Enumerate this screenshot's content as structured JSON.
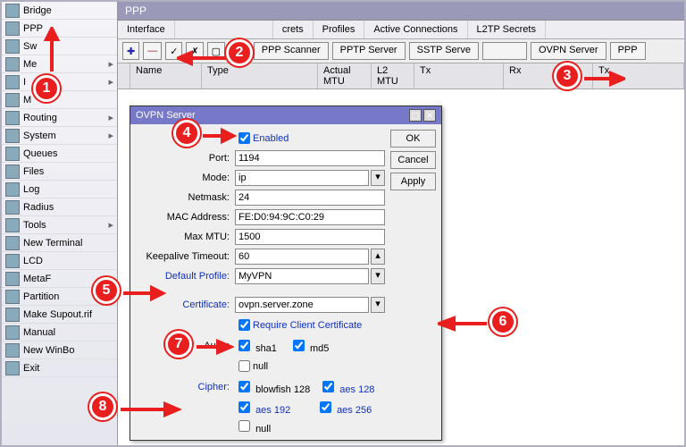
{
  "sidebar": {
    "items": [
      {
        "label": "Bridge",
        "hasSub": false
      },
      {
        "label": "PPP",
        "hasSub": false
      },
      {
        "label": "Sw",
        "hasSub": false
      },
      {
        "label": "Me",
        "hasSub": true
      },
      {
        "label": "I",
        "hasSub": true
      },
      {
        "label": "M",
        "hasSub": false
      },
      {
        "label": "Routing",
        "hasSub": true
      },
      {
        "label": "System",
        "hasSub": true
      },
      {
        "label": "Queues",
        "hasSub": false
      },
      {
        "label": "Files",
        "hasSub": false
      },
      {
        "label": "Log",
        "hasSub": false
      },
      {
        "label": "Radius",
        "hasSub": false
      },
      {
        "label": "Tools",
        "hasSub": true
      },
      {
        "label": "New Terminal",
        "hasSub": false
      },
      {
        "label": "LCD",
        "hasSub": false
      },
      {
        "label": "MetaF",
        "hasSub": false
      },
      {
        "label": "Partition",
        "hasSub": false
      },
      {
        "label": "Make Supout.rif",
        "hasSub": false
      },
      {
        "label": "Manual",
        "hasSub": false
      },
      {
        "label": "New WinBo",
        "hasSub": false
      },
      {
        "label": "Exit",
        "hasSub": false
      }
    ]
  },
  "main_title": "PPP",
  "tabs": [
    "Interface",
    "",
    "crets",
    "Profiles",
    "Active Connections",
    "L2TP Secrets"
  ],
  "toolbar": {
    "add": "✚",
    "remove": "—",
    "check": "✓",
    "x": "✗",
    "filter": "▢",
    "find": "🔍",
    "buttons": [
      "PPP Scanner",
      "PPTP Server",
      "SSTP Serve",
      "",
      "OVPN Server",
      "PPP"
    ]
  },
  "grid_cols": [
    "",
    "Name",
    "Type",
    "Actual MTU",
    "L2 MTU",
    "Tx",
    "Rx",
    "Tx"
  ],
  "dialog": {
    "title": "OVPN Server",
    "fields": {
      "enabled_label": "Enabled",
      "port_label": "Port:",
      "port": "1194",
      "mode_label": "Mode:",
      "mode": "ip",
      "netmask_label": "Netmask:",
      "netmask": "24",
      "mac_label": "MAC Address:",
      "mac": "FE:D0:94:9C:C0:29",
      "maxmtu_label": "Max MTU:",
      "maxmtu": "1500",
      "keepalive_label": "Keepalive Timeout:",
      "keepalive": "60",
      "profile_label": "Default Profile:",
      "profile": "MyVPN",
      "cert_label": "Certificate:",
      "cert": "ovpn.server.zone",
      "reqcert_label": "Require Client Certificate",
      "auth_label": "Auth.:",
      "auth_opts": {
        "sha1": "sha1",
        "md5": "md5",
        "null": "null"
      },
      "cipher_label": "Cipher:",
      "cipher_opts": {
        "bf": "blowfish 128",
        "a128": "aes 128",
        "a192": "aes 192",
        "a256": "aes 256",
        "null": "null"
      }
    },
    "buttons": {
      "ok": "OK",
      "cancel": "Cancel",
      "apply": "Apply"
    }
  },
  "callouts": [
    "1",
    "2",
    "3",
    "4",
    "5",
    "6",
    "7",
    "8"
  ]
}
